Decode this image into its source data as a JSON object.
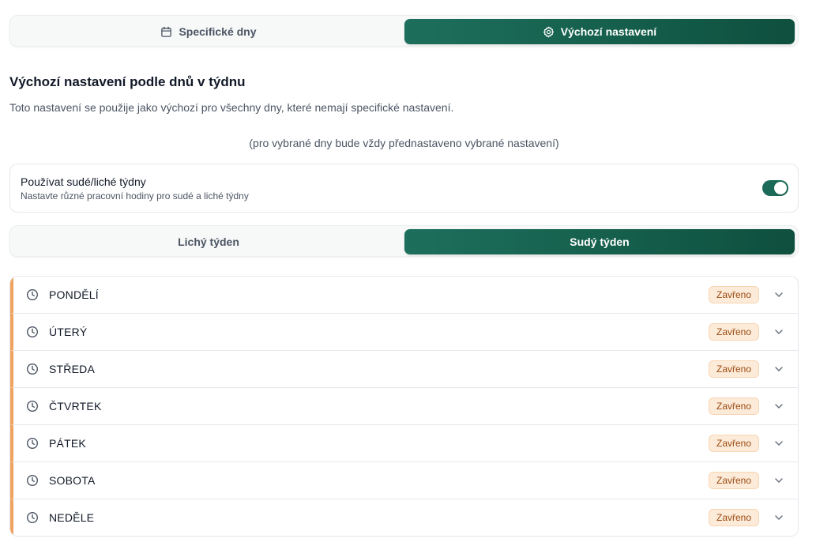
{
  "mode_tabs": {
    "specific_label": "Specifické dny",
    "specific_icon": "calendar-icon",
    "default_label": "Výchozí nastavení",
    "default_icon": "gear-icon",
    "active": "default"
  },
  "section": {
    "title": "Výchozí nastavení podle dnů v týdnu",
    "description": "Toto nastavení se použije jako výchozí pro všechny dny, které nemají specifické nastavení.",
    "note": "(pro vybrané dny bude vždy přednastaveno vybrané nastavení)"
  },
  "odd_even_toggle": {
    "title": "Používat sudé/liché týdny",
    "subtitle": "Nastavte různé pracovní hodiny pro sudé a liché týdny",
    "enabled": true
  },
  "week_tabs": {
    "odd_label": "Lichý týden",
    "even_label": "Sudý týden",
    "active": "even"
  },
  "days": [
    {
      "name": "PONDĚLÍ",
      "status": "Zavřeno"
    },
    {
      "name": "ÚTERÝ",
      "status": "Zavřeno"
    },
    {
      "name": "STŘEDA",
      "status": "Zavřeno"
    },
    {
      "name": "ČTVRTEK",
      "status": "Zavřeno"
    },
    {
      "name": "PÁTEK",
      "status": "Zavřeno"
    },
    {
      "name": "SOBOTA",
      "status": "Zavřeno"
    },
    {
      "name": "NEDĚLE",
      "status": "Zavřeno"
    }
  ],
  "colors": {
    "accent": "#155f4c",
    "closed_stripe": "#f0a35e",
    "closed_badge_bg": "#fdebd9",
    "closed_badge_text": "#9a4a12"
  }
}
